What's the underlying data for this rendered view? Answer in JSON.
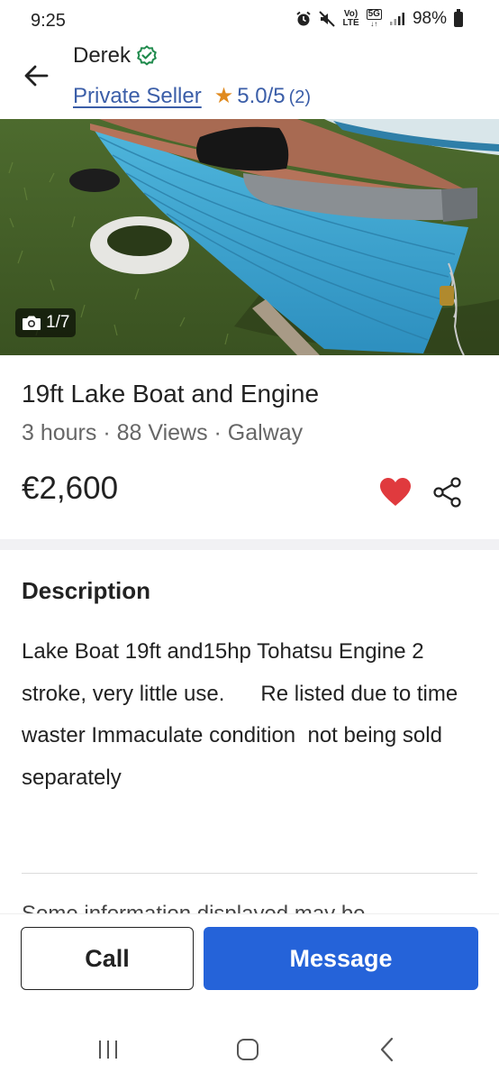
{
  "status_bar": {
    "time": "9:25",
    "network_top": "Vo)",
    "network_bottom": "LTE",
    "fiveg": "5G",
    "battery": "98%",
    "icons": [
      "alarm-icon",
      "mute-icon",
      "volte-icon",
      "5g-icon",
      "signal-icon",
      "battery-icon"
    ]
  },
  "header": {
    "seller_name": "Derek",
    "seller_type": "Private Seller",
    "rating": "5.0/5",
    "rating_count": "(2)",
    "icons": [
      "back-arrow-icon",
      "verified-icon",
      "star-icon"
    ]
  },
  "gallery": {
    "counter": "1/7",
    "icon": "camera-icon"
  },
  "listing": {
    "title": "19ft Lake Boat and Engine",
    "meta": "3 hours · 88 Views · Galway",
    "price": "€2,600",
    "favorited": true
  },
  "description": {
    "heading": "Description",
    "body": "Lake Boat 19ft and15hp Tohatsu Engine 2 stroke, very little use.      Re listed due to time waster Immaculate condition  not being sold separately"
  },
  "disclaimer": "Some information displayed may be",
  "actions": {
    "call_label": "Call",
    "message_label": "Message"
  },
  "colors": {
    "accent_blue": "#2563d9",
    "link_blue": "#3b5ea8",
    "star_orange": "#e08a1e",
    "heart_red": "#e03a3e",
    "verified_green": "#1f8a4c"
  }
}
